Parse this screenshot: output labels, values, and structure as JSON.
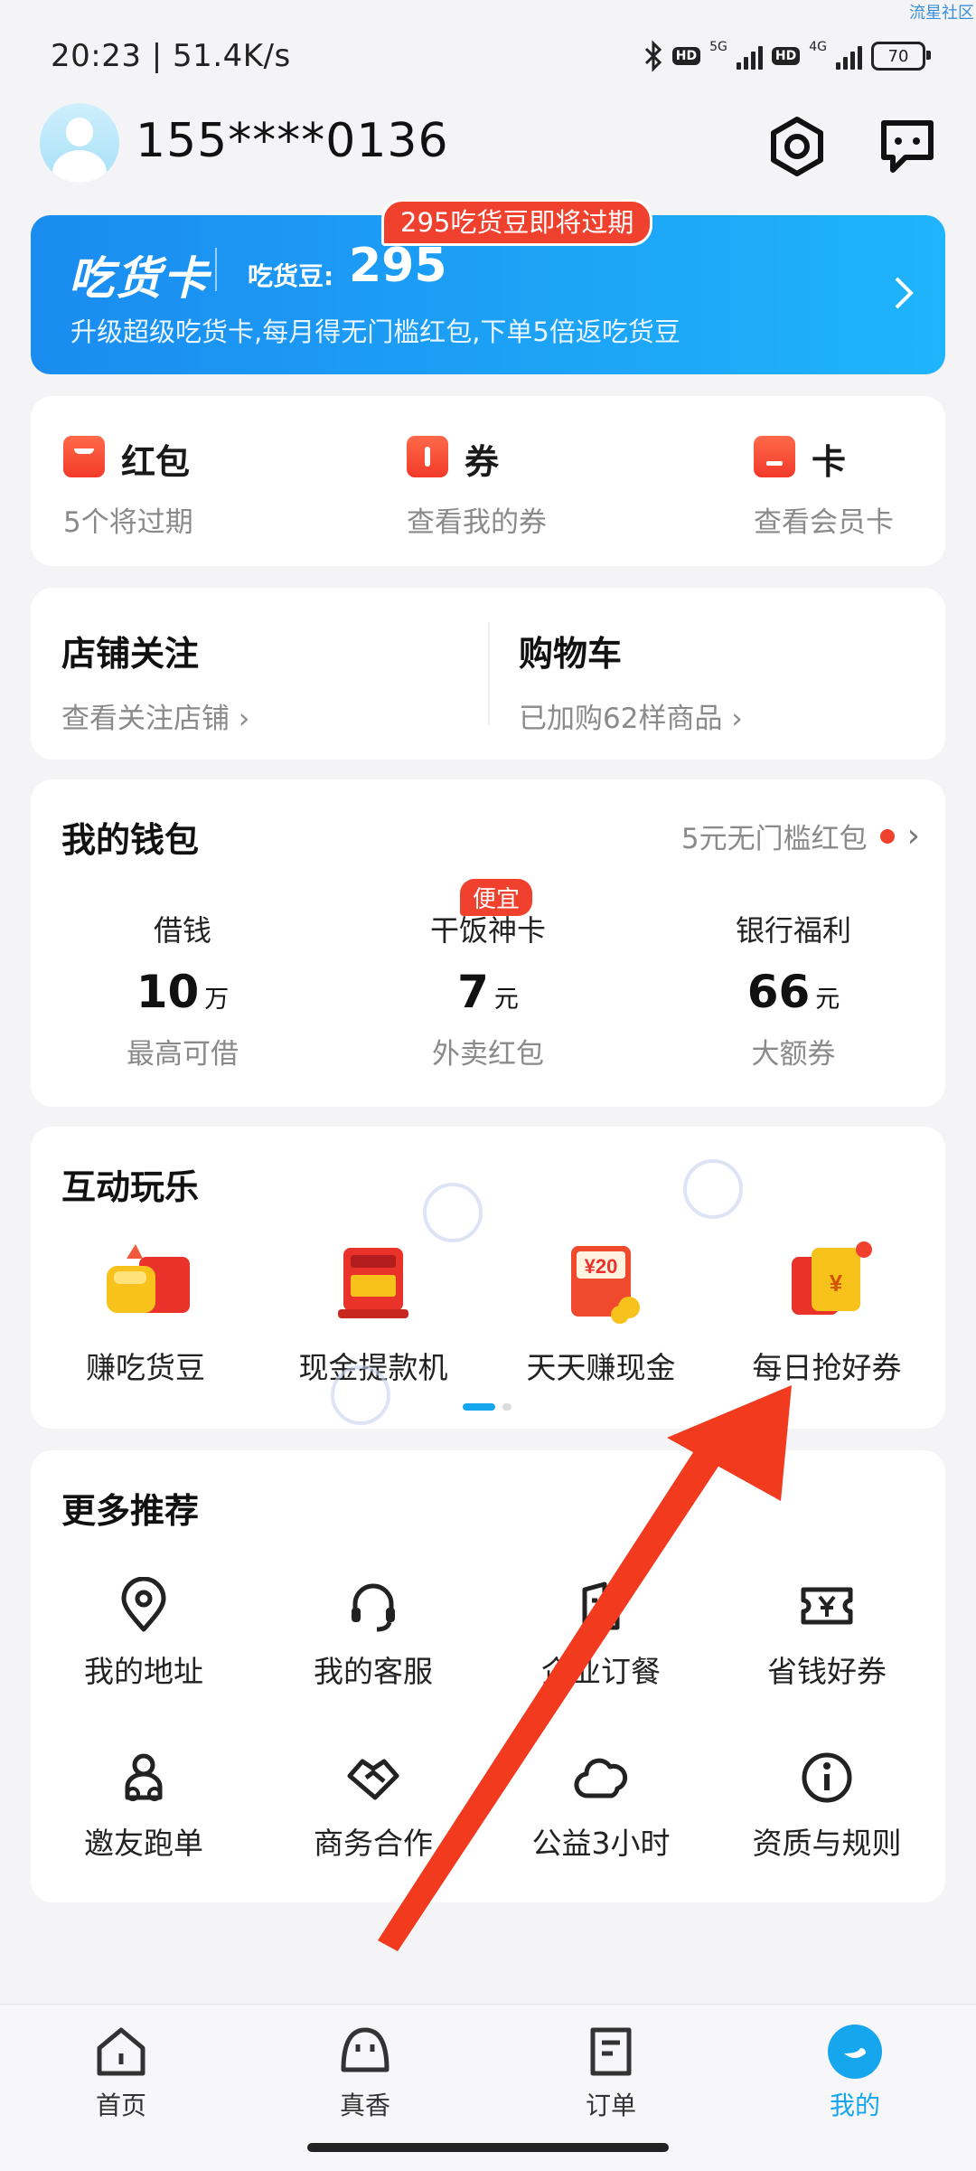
{
  "watermark": "流星社区",
  "status_bar": {
    "time": "20:23 | 51.4K/s",
    "battery": "70",
    "net1": "5G",
    "net2": "4G",
    "hd": "HD"
  },
  "header": {
    "phone": "155****0136"
  },
  "banner": {
    "title": "吃货卡",
    "beans_label": "吃货豆:",
    "beans_value": "295",
    "badge": "295吃货豆即将过期",
    "subtitle": "升级超级吃货卡,每月得无门槛红包,下单5倍返吃货豆"
  },
  "assets": [
    {
      "label": "红包",
      "sub": "5个将过期"
    },
    {
      "label": "券",
      "sub": "查看我的券"
    },
    {
      "label": "卡",
      "sub": "查看会员卡"
    }
  ],
  "follow": [
    {
      "title": "店铺关注",
      "sub": "查看关注店铺"
    },
    {
      "title": "购物车",
      "sub": "已加购62样商品"
    }
  ],
  "wallet": {
    "title": "我的钱包",
    "promo": "5元无门槛红包",
    "cheap_tag": "便宜",
    "items": [
      {
        "name": "借钱",
        "value": "10",
        "unit": "万",
        "sub": "最高可借"
      },
      {
        "name": "干饭神卡",
        "value": "7",
        "unit": "元",
        "sub": "外卖红包"
      },
      {
        "name": "银行福利",
        "value": "66",
        "unit": "元",
        "sub": "大额券"
      }
    ]
  },
  "play": {
    "title": "互动玩乐",
    "items": [
      {
        "label": "赚吃货豆",
        "icon": "gift-box-icon"
      },
      {
        "label": "现金提款机",
        "icon": "cash-machine-icon"
      },
      {
        "label": "天天赚现金",
        "icon": "cash-envelope-icon",
        "badge_text": "¥20"
      },
      {
        "label": "每日抢好券",
        "icon": "coupon-envelope-icon",
        "badge_text": "¥"
      }
    ],
    "page_indicator": {
      "pages": 2,
      "current": 1
    }
  },
  "more": {
    "title": "更多推荐",
    "items": [
      {
        "label": "我的地址",
        "icon": "location-pin-icon"
      },
      {
        "label": "我的客服",
        "icon": "headset-icon"
      },
      {
        "label": "企业订餐",
        "icon": "building-icon"
      },
      {
        "label": "省钱好券",
        "icon": "coupon-icon"
      },
      {
        "label": "邀友跑单",
        "icon": "scooter-rider-icon"
      },
      {
        "label": "商务合作",
        "icon": "handshake-icon"
      },
      {
        "label": "公益3小时",
        "icon": "cloud-icon"
      },
      {
        "label": "资质与规则",
        "icon": "info-icon"
      }
    ]
  },
  "bottom_nav": [
    {
      "label": "首页",
      "icon": "home-icon",
      "active": false
    },
    {
      "label": "真香",
      "icon": "face-icon",
      "active": false
    },
    {
      "label": "订单",
      "icon": "order-icon",
      "active": false
    },
    {
      "label": "我的",
      "icon": "profile-icon",
      "active": true
    }
  ],
  "colors": {
    "accent": "#16a6ee",
    "brand_red": "#f0402e",
    "annotation_arrow": "#f23a1e"
  }
}
